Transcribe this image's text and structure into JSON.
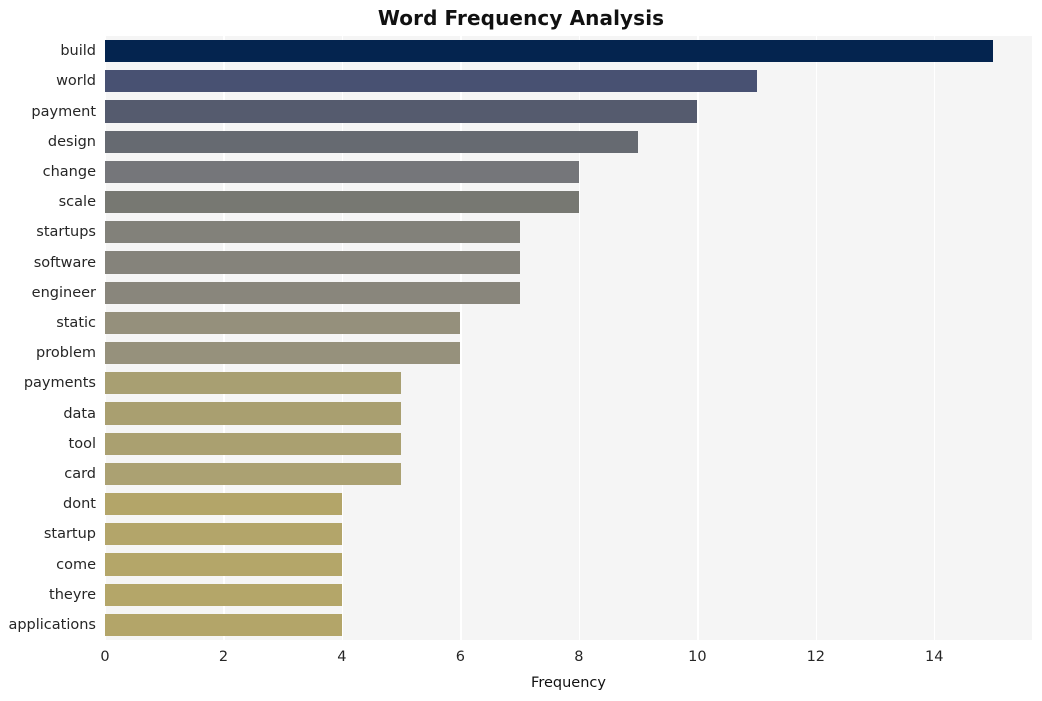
{
  "chart_data": {
    "type": "bar",
    "orientation": "horizontal",
    "title": "Word Frequency Analysis",
    "xlabel": "Frequency",
    "ylabel": "",
    "categories": [
      "build",
      "world",
      "payment",
      "design",
      "change",
      "scale",
      "startups",
      "software",
      "engineer",
      "static",
      "problem",
      "payments",
      "data",
      "tool",
      "card",
      "dont",
      "startup",
      "come",
      "theyre",
      "applications"
    ],
    "values": [
      15,
      11,
      10,
      9,
      8,
      8,
      7,
      7,
      7,
      6,
      6,
      5,
      5,
      5,
      5,
      4,
      4,
      4,
      4,
      4
    ],
    "bar_colors": [
      "#04244f",
      "#485172",
      "#555b6e",
      "#666a71",
      "#75767a",
      "#777872",
      "#82817a",
      "#85837b",
      "#89867c",
      "#95907c",
      "#96917c",
      "#a89f72",
      "#a99f70",
      "#aaa070",
      "#aba172",
      "#b3a569",
      "#b3a56a",
      "#b4a669",
      "#b4a669",
      "#b3a569"
    ],
    "xticks": [
      0,
      2,
      4,
      6,
      8,
      10,
      12,
      14
    ],
    "xtick_labels": [
      "0",
      "2",
      "4",
      "6",
      "8",
      "10",
      "12",
      "14"
    ],
    "xlim": [
      0,
      15.65
    ],
    "gridlines": "vertical-white",
    "grid": true,
    "legend": "none",
    "plot_background": "#f5f5f5",
    "figure_background": "#ffffff"
  }
}
